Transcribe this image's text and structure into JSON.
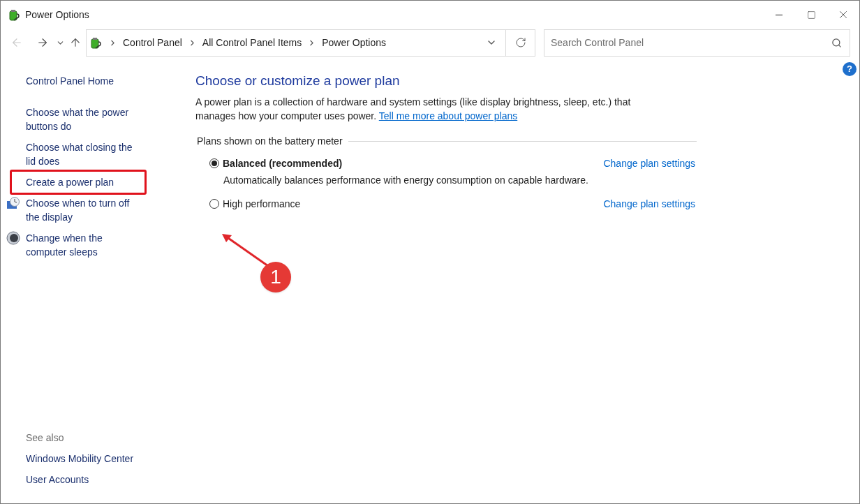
{
  "window": {
    "title": "Power Options"
  },
  "navigation": {
    "back_disabled": true,
    "forward_disabled": false
  },
  "breadcrumbs": [
    "Control Panel",
    "All Control Panel Items",
    "Power Options"
  ],
  "search": {
    "placeholder": "Search Control Panel"
  },
  "help": {
    "label": "?"
  },
  "sidebar": {
    "home": "Control Panel Home",
    "items": [
      {
        "kind": "link",
        "label": "Choose what the power buttons do",
        "highlighted": false
      },
      {
        "kind": "link",
        "label": "Choose what closing the lid does",
        "highlighted": false
      },
      {
        "kind": "link",
        "label": "Create a power plan",
        "highlighted": true
      },
      {
        "kind": "display",
        "label": "Choose when to turn off the display",
        "highlighted": false
      },
      {
        "kind": "sleep",
        "label": "Change when the computer sleeps",
        "highlighted": false
      }
    ],
    "see_also": {
      "heading": "See also",
      "links": [
        "Windows Mobility Center",
        "User Accounts"
      ]
    }
  },
  "main": {
    "heading": "Choose or customize a power plan",
    "intro": "A power plan is a collection of hardware and system settings (like display brightness, sleep, etc.) that manages how your computer uses power.",
    "intro_link": "Tell me more about power plans",
    "group_label": "Plans shown on the battery meter",
    "plans": [
      {
        "name": "Balanced (recommended)",
        "selected": true,
        "description": "Automatically balances performance with energy consumption on capable hardware.",
        "link": "Change plan settings"
      },
      {
        "name": "High performance",
        "selected": false,
        "link": "Change plan settings"
      }
    ]
  },
  "annotation": {
    "badge": "1"
  }
}
